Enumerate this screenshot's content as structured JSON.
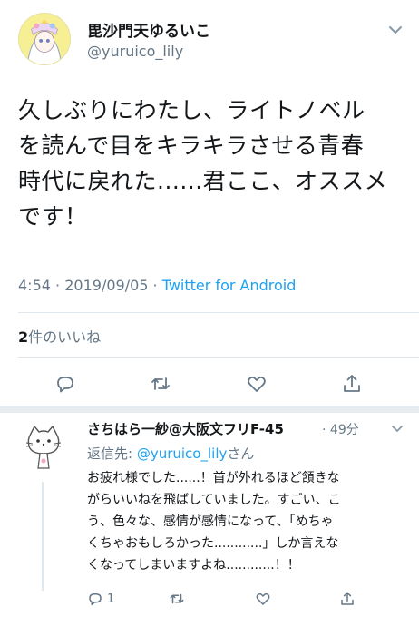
{
  "tweet": {
    "display_name": "毘沙門天ゆるいこ",
    "handle": "@yuruico_lily",
    "text_lines": [
      "久しぶりにわたし、ライトノベル",
      "を読んで目をキラキラさせる青春",
      "時代に戻れた......君ここ、オススメ",
      "です！"
    ],
    "time": "4:54",
    "date": "2019/09/05",
    "separator": "·",
    "source": "Twitter for Android",
    "likes_count": "2",
    "likes_label": "件のいいね"
  },
  "actions": [
    {
      "icon": "reply-icon"
    },
    {
      "icon": "retweet-icon"
    },
    {
      "icon": "like-icon"
    },
    {
      "icon": "share-icon"
    }
  ],
  "reply": {
    "display_name": "さちはら一紗@大阪文フリF-45",
    "time_sep": "·",
    "time": "49分",
    "replying_prefix": "返信先: ",
    "replying_to": "@yuruico_lily",
    "replying_suffix": "さん",
    "text_lines": [
      "お疲れ様でした......！首が外れるほど頷きな",
      "がらいいねを飛ばしていました。すごい、こ",
      "う、色々な、感情が感情になって、「めちゃ",
      "くちゃおもしろかった............」しか言えな",
      "くなってしまいますよね............！！"
    ],
    "reply_count": "1"
  },
  "colors": {
    "text": "#14171a",
    "muted": "#657786",
    "link": "#1da1f2",
    "divider": "#e1e8ed"
  }
}
